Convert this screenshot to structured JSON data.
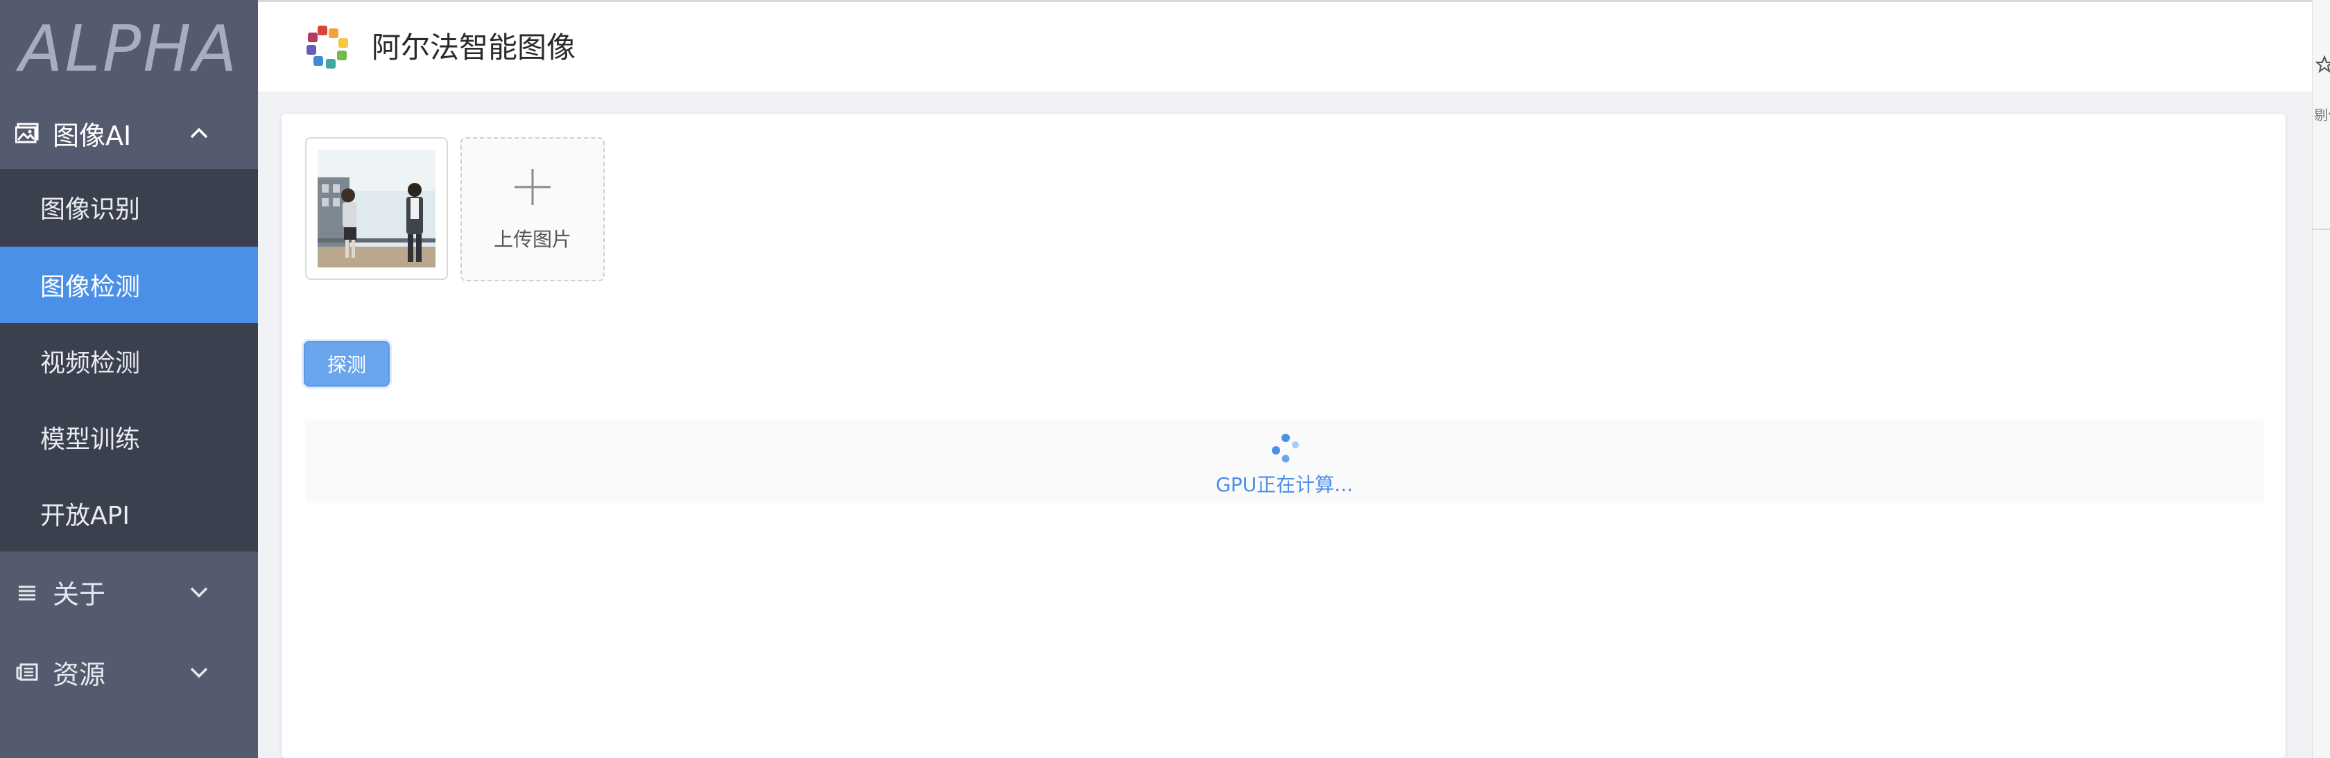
{
  "sidebar": {
    "brand": "ALPHA",
    "groups": [
      {
        "label": "图像AI",
        "icon": "image-icon",
        "expanded": true
      },
      {
        "label": "关于",
        "icon": "list-icon",
        "expanded": false
      },
      {
        "label": "资源",
        "icon": "newspaper-icon",
        "expanded": false
      }
    ],
    "items": [
      {
        "label": "图像识别",
        "active": false
      },
      {
        "label": "图像检测",
        "active": true
      },
      {
        "label": "视频检测",
        "active": false
      },
      {
        "label": "模型训练",
        "active": false
      },
      {
        "label": "开放API",
        "active": false
      }
    ]
  },
  "header": {
    "title": "阿尔法智能图像",
    "logo": "alpha-logo"
  },
  "browser": {
    "side_text": "剔作"
  },
  "main": {
    "upload_label": "上传图片",
    "detect_button": "探测",
    "loading_text": "GPU正在计算..."
  },
  "colors": {
    "sidebar_bg": "#555b6e",
    "submenu_bg": "#3b404e",
    "accent": "#4a8fe8",
    "button": "#6aa6ee"
  }
}
